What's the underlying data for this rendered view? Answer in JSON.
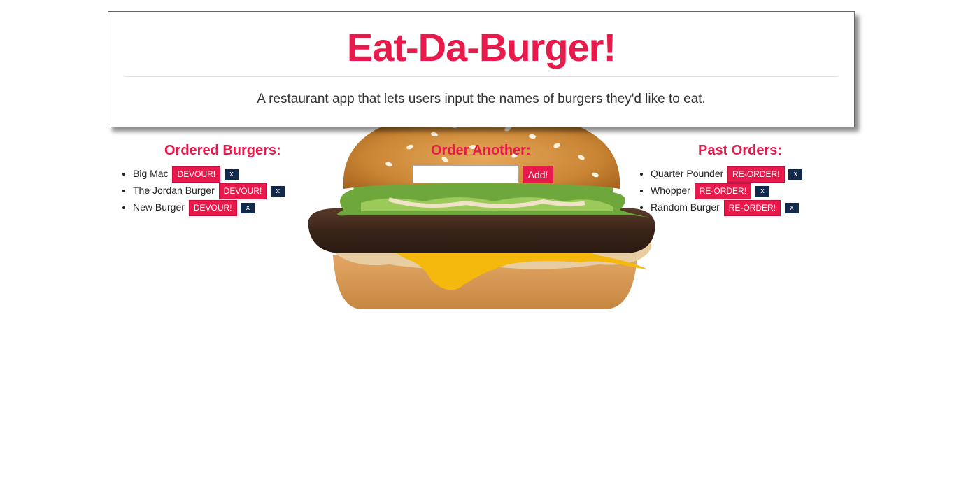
{
  "header": {
    "title": "Eat-Da-Burger!",
    "subtitle": "A restaurant app that lets users input the names of burgers they'd like to eat."
  },
  "ordered": {
    "title": "Ordered Burgers:",
    "items": [
      {
        "name": "Big Mac",
        "action": "DEVOUR!",
        "remove": "x"
      },
      {
        "name": "The Jordan Burger",
        "action": "DEVOUR!",
        "remove": "x"
      },
      {
        "name": "New Burger",
        "action": "DEVOUR!",
        "remove": "x"
      }
    ]
  },
  "order_form": {
    "title": "Order Another:",
    "input_value": "",
    "add_label": "Add!"
  },
  "past": {
    "title": "Past Orders:",
    "items": [
      {
        "name": "Quarter Pounder",
        "action": "RE-ORDER!",
        "remove": "x"
      },
      {
        "name": "Whopper",
        "action": "RE-ORDER!",
        "remove": "x"
      },
      {
        "name": "Random Burger",
        "action": "RE-ORDER!",
        "remove": "x"
      }
    ]
  },
  "colors": {
    "accent": "#e8194b",
    "remove_button": "#13294b"
  },
  "icons": {
    "burger_image": "burger-image"
  }
}
